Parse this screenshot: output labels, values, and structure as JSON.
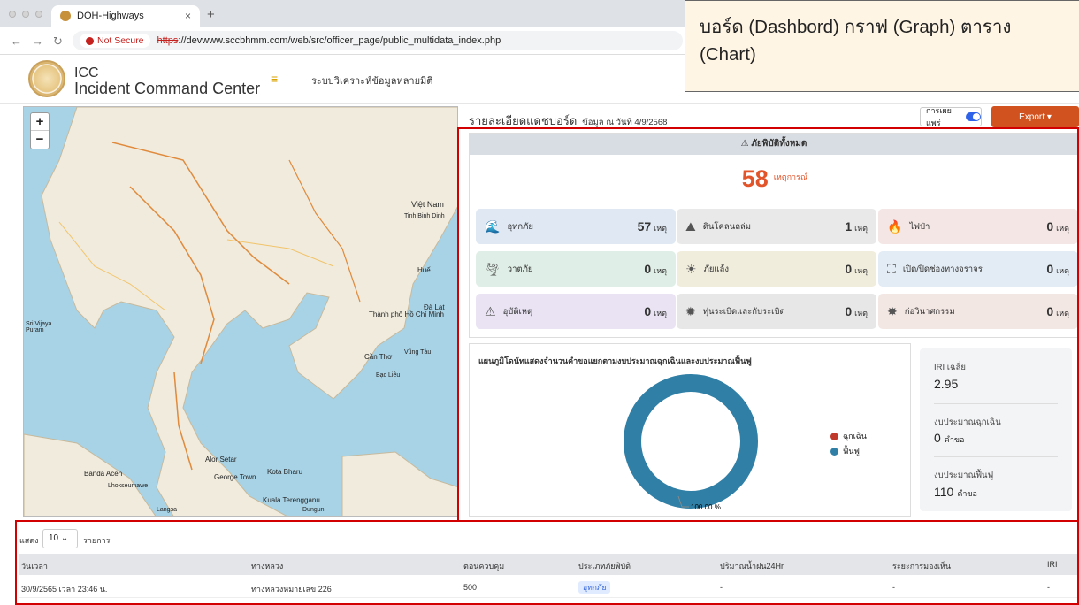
{
  "browser": {
    "tab_title": "DOH-Highways",
    "not_secure": "Not Secure",
    "url_proto": "https",
    "url_rest": "://devwww.sccbhmm.com/web/src/officer_page/public_multidata_index.php"
  },
  "header": {
    "brand_line1": "ICC",
    "brand_line2": "Incident Command Center",
    "menu_item": "ระบบวิเคราะห์ข้อมูลหลายมิติ"
  },
  "callout": {
    "text": "บอร์ด (Dashbord) กราฟ (Graph) ตาราง (Chart)"
  },
  "map": {
    "labels": [
      "Thành phố Hồ Chí Minh",
      "Kuala Terengganu",
      "Banda Aceh",
      "George Town",
      "Kota Bharu",
      "Việt Nam",
      "Cần Thơ",
      "Huế",
      "Sri Vijaya Puram",
      "Đà Lạt",
      "Bạc Liêu",
      "Vũng Tàu",
      "Alor Setar",
      "Lhokseumawe",
      "Langsa",
      "Dungun",
      "Tinh Binh Dinh"
    ],
    "zoom_in": "+",
    "zoom_out": "−"
  },
  "dashboard": {
    "title": "รายละเอียดแดชบอร์ด",
    "date_text": "ข้อมูล ณ วันที่ 4/9/2568",
    "publish_label": "การเผยแพร่",
    "export_label": "Export ▾",
    "total_header": "ภัยพิบัติทั้งหมด",
    "total_value": "58",
    "total_unit": "เหตุการณ์",
    "cards": [
      {
        "label": "อุทกภัย",
        "value": "57",
        "unit": "เหตุ",
        "icon": "flood-icon",
        "glyph": "🌊"
      },
      {
        "label": "ดินโคลนถล่ม",
        "value": "1",
        "unit": "เหตุ",
        "icon": "landslide-icon",
        "glyph": "⛰"
      },
      {
        "label": "ไฟป่า",
        "value": "0",
        "unit": "เหตุ",
        "icon": "wildfire-icon",
        "glyph": "🔥"
      },
      {
        "label": "วาตภัย",
        "value": "0",
        "unit": "เหตุ",
        "icon": "storm-icon",
        "glyph": "🌪"
      },
      {
        "label": "ภัยแล้ง",
        "value": "0",
        "unit": "เหตุ",
        "icon": "drought-icon",
        "glyph": "☀"
      },
      {
        "label": "เปิด/ปิดช่องทางจราจร",
        "value": "0",
        "unit": "เหตุ",
        "icon": "traffic-lane-icon",
        "glyph": "⛶"
      },
      {
        "label": "อุบัติเหตุ",
        "value": "0",
        "unit": "เหตุ",
        "icon": "accident-icon",
        "glyph": "⚠"
      },
      {
        "label": "ทุ่นระเบิดและกับระเบิด",
        "value": "0",
        "unit": "เหตุ",
        "icon": "landmine-icon",
        "glyph": "✹"
      },
      {
        "label": "ก่อวินาศกรรม",
        "value": "0",
        "unit": "เหตุ",
        "icon": "sabotage-icon",
        "glyph": "✸"
      }
    ],
    "card_colors": [
      "#dfe8f3",
      "#e9e9e9",
      "#f3e6e4",
      "#dfeee6",
      "#f1eddd",
      "#e3ecf4",
      "#e9e3f3",
      "#e7e7e7",
      "#f3e7e3"
    ]
  },
  "chart_data": {
    "type": "pie",
    "title": "แผนภูมิโดนัทแสดงจำนวนคำขอแยกตามงบประมาณฉุกเฉินและงบประมาณฟื้นฟู",
    "series": [
      {
        "name": "ฉุกเฉิน",
        "value": 0,
        "color": "#c0392b"
      },
      {
        "name": "ฟื้นฟู",
        "value": 110,
        "color": "#2f7fa6"
      }
    ],
    "data_label": "100.00 %"
  },
  "stats": {
    "iri_label": "IRI เฉลี่ย",
    "iri_value": "2.95",
    "emergency_label": "งบประมาณฉุกเฉิน",
    "emergency_value": "0",
    "emergency_unit": "คำขอ",
    "recovery_label": "งบประมาณฟื้นฟู",
    "recovery_value": "110",
    "recovery_unit": "คำขอ"
  },
  "table": {
    "show_label": "แสดง",
    "page_size": "10",
    "entries_label": "รายการ",
    "columns": [
      "วันเวลา",
      "ทางหลวง",
      "ตอนควบคุม",
      "ประเภทภัยพิบัติ",
      "ปริมาณน้ำฝน24Hr",
      "ระยะการมองเห็น",
      "IRI"
    ],
    "rows": [
      [
        "30/9/2565 เวลา 23:46 น.",
        "ทางหลวงหมายเลข 226",
        "500",
        "อุทกภัย",
        "-",
        "-",
        "-"
      ]
    ]
  }
}
